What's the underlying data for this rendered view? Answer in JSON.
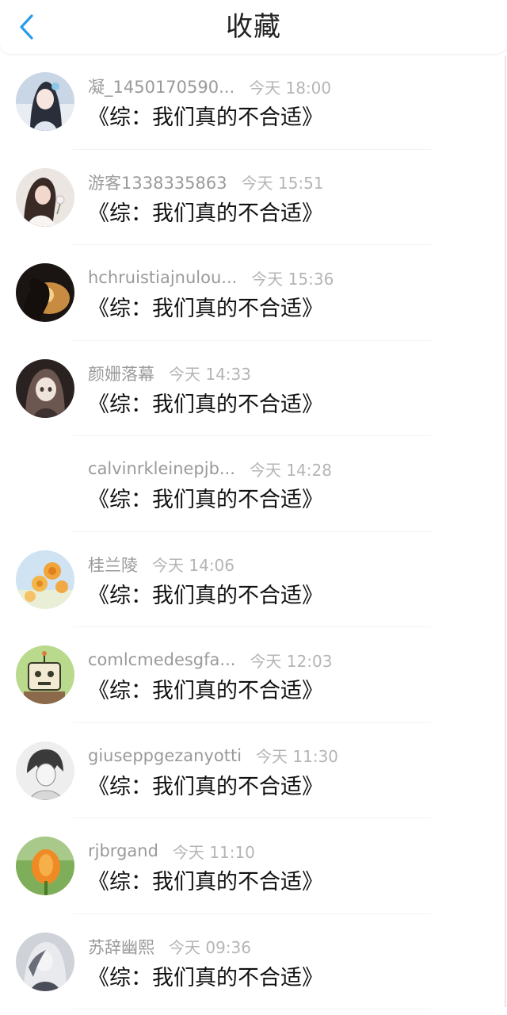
{
  "header": {
    "title": "收藏",
    "back_icon": "chevron-left-icon",
    "accent_color": "#2a9bea"
  },
  "items": [
    {
      "user": "凝_1450170590...",
      "time": "今天 18:00",
      "book": "《综：我们真的不合适》",
      "avatar": "avatar-girl-blue-icon"
    },
    {
      "user": "游客1338335863",
      "time": "今天 15:51",
      "book": "《综：我们真的不合适》",
      "avatar": "avatar-woman-flower-icon"
    },
    {
      "user": "hchruistiajnulou...",
      "time": "今天 15:36",
      "book": "《综：我们真的不合适》",
      "avatar": "avatar-silhouette-sunset-icon"
    },
    {
      "user": "颜姗落幕",
      "time": "今天 14:33",
      "book": "《综：我们真的不合适》",
      "avatar": "avatar-anime-girl-dark-icon"
    },
    {
      "user": "calvinrkleinepjb...",
      "time": "今天 14:28",
      "book": "《综：我们真的不合适》",
      "avatar": "none"
    },
    {
      "user": "桂兰陵",
      "time": "今天 14:06",
      "book": "《综：我们真的不合适》",
      "avatar": "avatar-orange-flowers-icon"
    },
    {
      "user": "comlcmedesgfa...",
      "time": "今天 12:03",
      "book": "《综：我们真的不合适》",
      "avatar": "avatar-cartoon-robot-icon"
    },
    {
      "user": "giuseppgezanyotti",
      "time": "今天 11:30",
      "book": "《综：我们真的不合适》",
      "avatar": "avatar-anime-sketch-icon"
    },
    {
      "user": "rjbrgand",
      "time": "今天 11:10",
      "book": "《综：我们真的不合适》",
      "avatar": "avatar-orange-flower-icon"
    },
    {
      "user": "苏辞幽熙",
      "time": "今天 09:36",
      "book": "《综：我们真的不合适》",
      "avatar": "avatar-anime-grey-icon"
    }
  ]
}
